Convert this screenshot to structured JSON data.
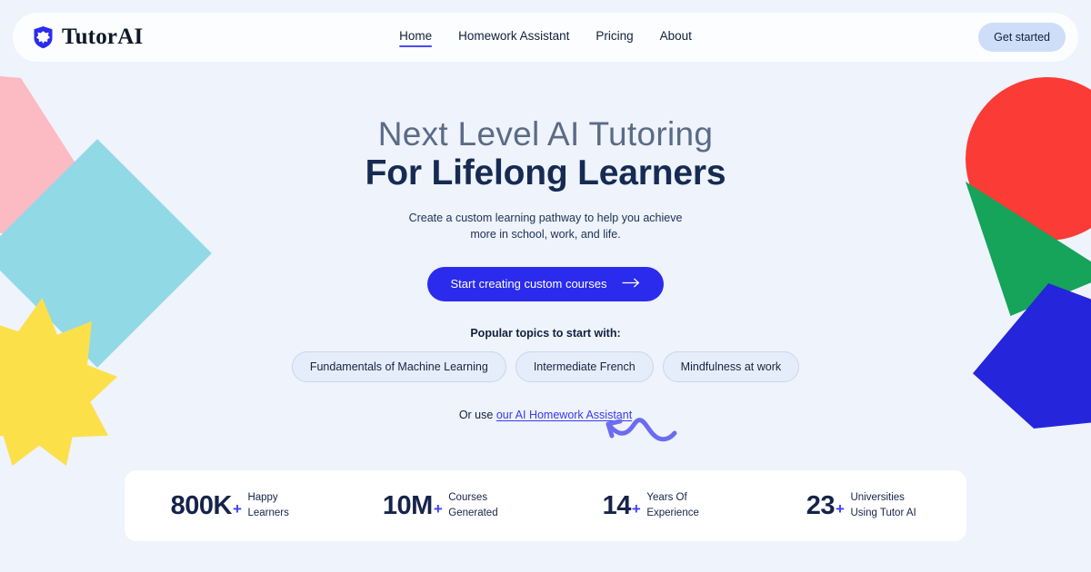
{
  "brand": {
    "name": "TutorAI",
    "icon": "shield-graduation-icon"
  },
  "nav": {
    "items": [
      {
        "label": "Home",
        "active": true
      },
      {
        "label": "Homework Assistant",
        "active": false
      },
      {
        "label": "Pricing",
        "active": false
      },
      {
        "label": "About",
        "active": false
      }
    ],
    "cta_label": "Get started"
  },
  "hero": {
    "headline_thin": "Next Level AI Tutoring",
    "headline_bold": "For Lifelong Learners",
    "subtitle": "Create a custom learning pathway to help you achieve more in school, work, and life.",
    "cta_label": "Start creating custom courses",
    "cta_icon": "arrow-right-icon",
    "popular_label": "Popular topics to start with:",
    "topics": [
      "Fundamentals of Machine Learning",
      "Intermediate French",
      "Mindfulness at work"
    ],
    "or_use_prefix": "Or use ",
    "or_use_link": "our AI Homework Assistant",
    "squiggle_icon": "hand-drawn-arrow-icon"
  },
  "stats": [
    {
      "value": "800K",
      "plus": "+",
      "label": "Happy\nLearners"
    },
    {
      "value": "10M",
      "plus": "+",
      "label": "Courses\nGenerated"
    },
    {
      "value": "14",
      "plus": "+",
      "label": "Years Of\nExperience"
    },
    {
      "value": "23",
      "plus": "+",
      "label": "Universities\nUsing Tutor AI"
    }
  ],
  "colors": {
    "background": "#EEF3FC",
    "primary_blue": "#2B2BEE",
    "accent_blue": "#4040EE",
    "navy": "#16234A",
    "header_bg": "#FCFDFF",
    "pill_bg": "#E6EDFA",
    "get_started_bg": "#CFDEF8",
    "shape_pink": "#FCBAC3",
    "shape_cyan": "#92D9E6",
    "shape_yellow": "#FBE04A",
    "shape_red": "#FB3B35",
    "shape_green": "#16A35A",
    "shape_blue": "#2525DB",
    "squiggle": "#6C6CF0"
  }
}
